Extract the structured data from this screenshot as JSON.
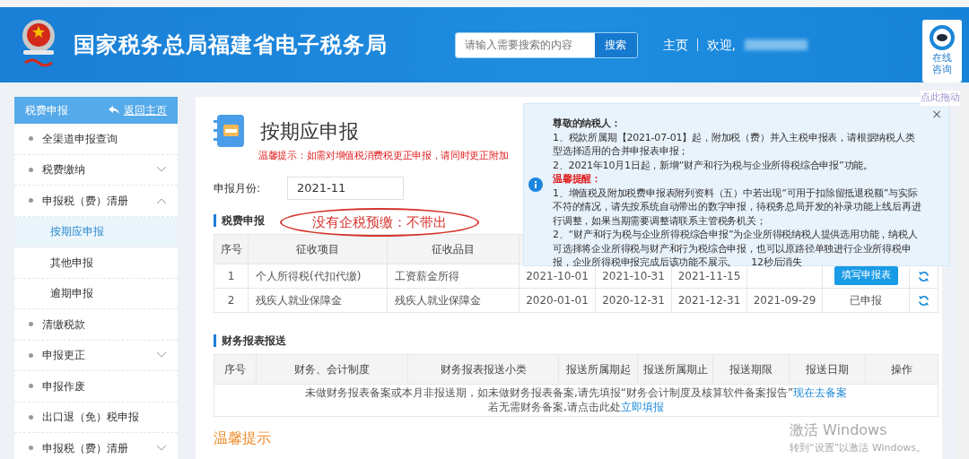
{
  "header": {
    "title": "国家税务总局福建省电子税务局",
    "search": {
      "placeholder": "请输入需要搜索的内容",
      "button": "搜索"
    },
    "nav": [
      "主页",
      "欢迎,"
    ]
  },
  "consult": {
    "label": "在线咨询",
    "drag_hint": "点此拖动"
  },
  "sidebar": {
    "title": "税费申报",
    "back": "返回主页",
    "items": [
      {
        "label": "全渠道申报查询"
      },
      {
        "label": "税费缴纳",
        "expanded": false
      },
      {
        "label": "申报税（费）清册",
        "expanded": true,
        "children": [
          {
            "label": "按期应申报",
            "selected": true
          },
          {
            "label": "其他申报",
            "selected": false
          },
          {
            "label": "逾期申报",
            "selected": false
          }
        ]
      },
      {
        "label": "清缴税款"
      },
      {
        "label": "申报更正",
        "expanded": false
      },
      {
        "label": "申报作废"
      },
      {
        "label": "出口退（免）税申报"
      },
      {
        "label": "申报税（费）清册",
        "expanded": false
      }
    ]
  },
  "page": {
    "title": "按期应申报",
    "warning": "温馨提示：如需对增值税消费税更正申报，请同时更正附加",
    "month_label": "申报月份:",
    "month_value": "2021-11",
    "annotation": "没有企税预缴：不带出",
    "tax_section": {
      "title": "税费申报",
      "columns": [
        "序号",
        "征收项目",
        "征收品目",
        "",
        "",
        "",
        "",
        "",
        ""
      ],
      "rows": [
        {
          "cells": [
            "1",
            "个人所得税(代扣代缴)",
            "工资薪金所得",
            "2021-10-01",
            "2021-10-31",
            "2021-11-15",
            ""
          ],
          "action": {
            "kind": "button",
            "label": "填写申报表"
          }
        },
        {
          "cells": [
            "2",
            "残疾人就业保障金",
            "残疾人就业保障金",
            "2020-01-01",
            "2020-12-31",
            "2021-12-31",
            "2021-09-29"
          ],
          "action": {
            "kind": "status",
            "label": "已申报"
          }
        }
      ]
    },
    "report_section": {
      "title": "财务报表报送",
      "columns": [
        "序号",
        "财务、会计制度",
        "财务报表报送小类",
        "报送所属期起",
        "报送所属期止",
        "报送期限",
        "报送日期",
        "操作"
      ],
      "empty_lines": [
        {
          "text": "未做财务报表备案或本月非报送期，如未做财务报表备案,请先填报“财务会计制度及核算软件备案报告”",
          "link": "现在去备案"
        },
        {
          "text": "若无需财务备案,请点击此处",
          "link": "立即填报"
        }
      ]
    },
    "tips_title": "温馨提示"
  },
  "notice": {
    "greeting": "尊敬的纳税人：",
    "lines": [
      "1、税款所属期【2021-07-01】起，附加税（费）并入主税申报表，请根据纳税人类型选择适用的合并申报表申报；",
      "2、2021年10月1日起，新增“财产和行为税与企业所得税综合申报”功能。"
    ],
    "reminder_title": "温馨提醒：",
    "reminders": [
      "1、增值税及附加税费申报表附列资料（五）中若出现“可用于扣除留抵退税额”与实际不符的情况，请先按系统自动带出的数字申报，待税务总局开发的补录功能上线后再进行调整，如果当期需要调整请联系主管税务机关；",
      "2、“财产和行为税与企业所得税综合申报”为企业所得税纳税人提供选用功能，纳税人可选择将企业所得税与财产和行为税综合申报，也可以原路径单独进行企业所得税申报，企业所得税申报完成后该功能不展示。"
    ],
    "countdown": "12秒后消失",
    "close": "×"
  },
  "os_notice": [
    "激活 Windows",
    "转到“设置”以激活 Windows。"
  ]
}
